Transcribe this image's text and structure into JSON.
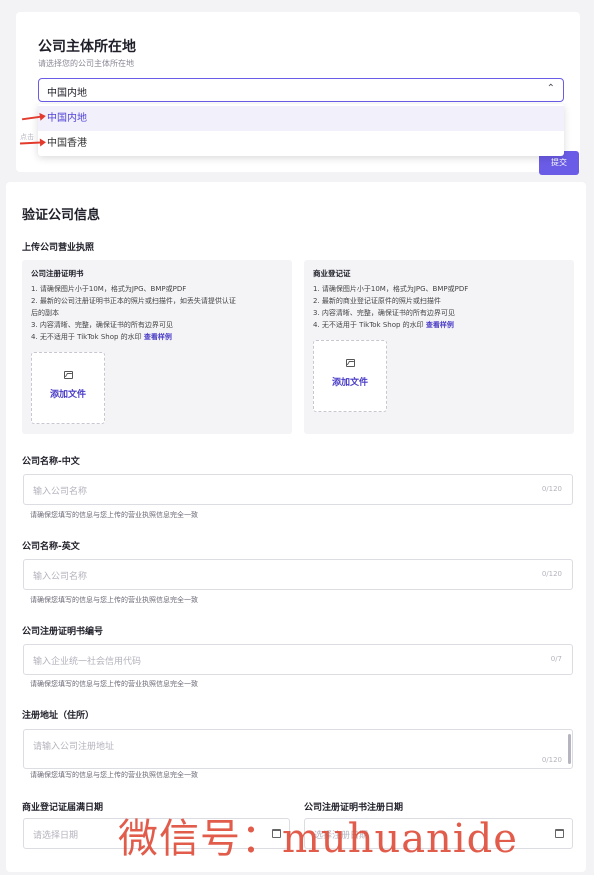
{
  "region": {
    "title": "公司主体所在地",
    "subtitle": "请选择您的公司主体所在地",
    "selected": "中国内地",
    "options": [
      "中国内地",
      "中国香港"
    ],
    "hint_fragment": "点击",
    "submit_label": "提交"
  },
  "verify": {
    "title": "验证公司信息",
    "upload_title": "上传公司营业执照",
    "boxes": [
      {
        "title": "公司注册证明书",
        "lines": [
          "1. 请确保图片小于10M，格式为JPG、BMP或PDF",
          "2. 最新的公司注册证明书正本的照片或扫描件，如丢失请提供认证",
          "后的副本",
          "3. 内容清晰、完整，确保证书的所有边界可见",
          "4. 无不适用于 TikTok Shop 的水印"
        ],
        "link": "查看样例",
        "add_label": "添加文件"
      },
      {
        "title": "商业登记证",
        "lines": [
          "1. 请确保图片小于10M，格式为JPG、BMP或PDF",
          "2. 最新的商业登记证原件的照片或扫描件",
          "3. 内容清晰、完整，确保证书的所有边界可见",
          "4. 无不适用于 TikTok Shop 的水印"
        ],
        "link": "查看样例",
        "add_label": "添加文件"
      }
    ],
    "fields": [
      {
        "label": "公司名称-中文",
        "placeholder": "输入公司名称",
        "count": "0/120",
        "help": "请确保您填写的信息与您上传的营业执照信息完全一致"
      },
      {
        "label": "公司名称-英文",
        "placeholder": "输入公司名称",
        "count": "0/120",
        "help": "请确保您填写的信息与您上传的营业执照信息完全一致"
      },
      {
        "label": "公司注册证明书编号",
        "placeholder": "输入企业统一社会信用代码",
        "count": "0/7",
        "help": "请确保您填写的信息与您上传的营业执照信息完全一致"
      },
      {
        "label": "注册地址（住所）",
        "placeholder": "请输入公司注册地址",
        "count": "0/120",
        "help": "请确保您填写的信息与您上传的营业执照信息完全一致"
      }
    ],
    "dates": [
      {
        "label": "商业登记证届满日期",
        "placeholder": "请选择日期"
      },
      {
        "label": "公司注册证明书注册日期",
        "placeholder": "选择注册日期"
      }
    ]
  },
  "watermark": "微信号：muhuanide",
  "colors": {
    "accent": "#6b5ce7",
    "link": "#4a3cc7",
    "arrow": "#e23b2e"
  }
}
